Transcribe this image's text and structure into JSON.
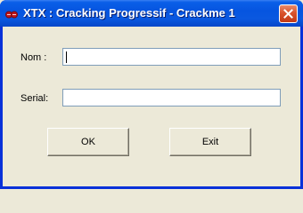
{
  "window": {
    "title": "XTX : Cracking Progressif - Crackme 1"
  },
  "form": {
    "nom_label": "Nom :",
    "serial_label": "Serial:",
    "nom_value": "",
    "serial_value": ""
  },
  "buttons": {
    "ok_label": "OK",
    "exit_label": "Exit"
  },
  "icons": {
    "app": "red-app-icon",
    "close": "close-icon"
  }
}
